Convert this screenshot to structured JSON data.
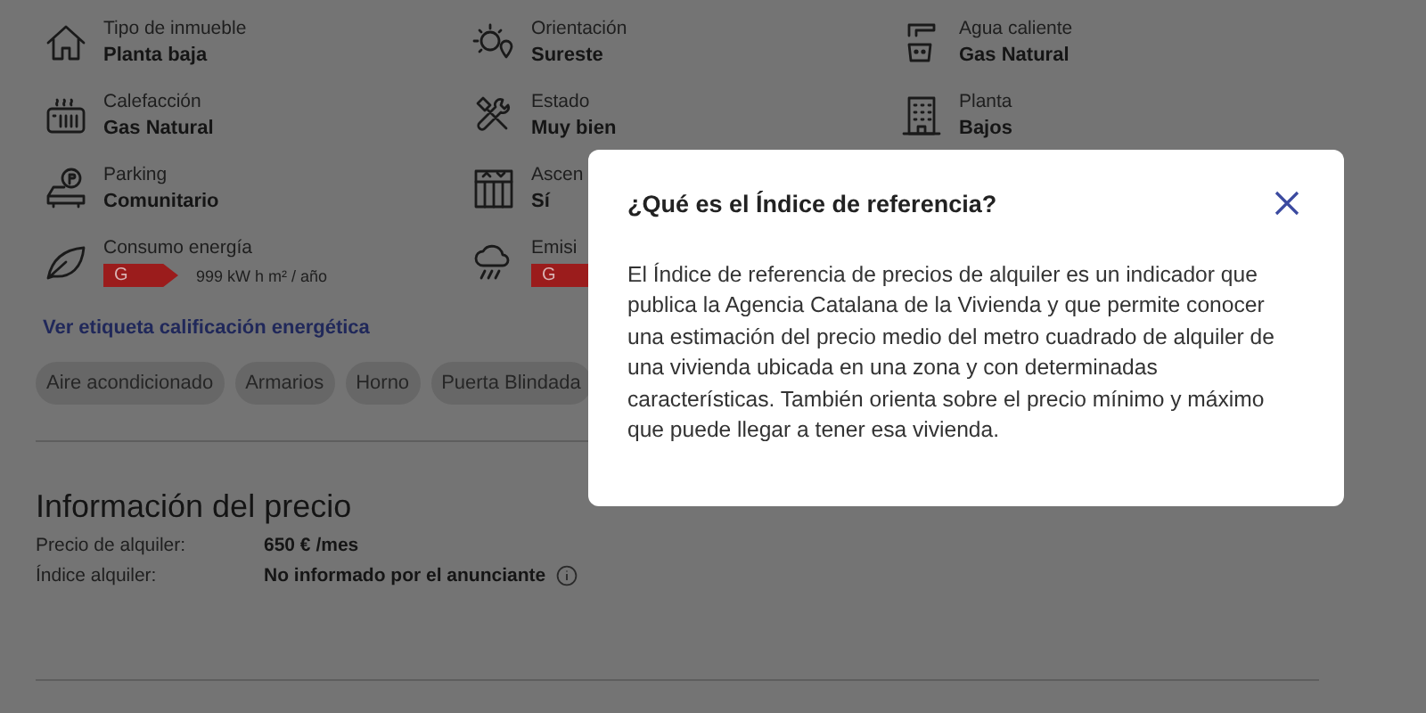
{
  "feature_rows": [
    [
      {
        "kind": "text",
        "label": "Tipo de inmueble",
        "value": "Planta baja"
      },
      {
        "kind": "text",
        "label": "Orientación",
        "value": "Sureste"
      },
      {
        "kind": "text",
        "label": "Agua caliente",
        "value": "Gas Natural"
      }
    ],
    [
      {
        "kind": "text",
        "label": "Calefacción",
        "value": "Gas Natural"
      },
      {
        "kind": "text",
        "label": "Estado",
        "value": "Muy bien"
      },
      {
        "kind": "text",
        "label": "Planta",
        "value": "Bajos"
      }
    ],
    [
      {
        "kind": "text",
        "label": "Parking",
        "value": "Comunitario"
      },
      {
        "kind": "text",
        "label": "Ascen",
        "value": "Sí"
      }
    ],
    [
      {
        "kind": "energy",
        "label": "Consumo energía",
        "rating": "G",
        "color": "#9b1c1c",
        "reading": "999 kW h m² / año"
      },
      {
        "kind": "energy",
        "label": "Emisi",
        "rating": "G",
        "color": "#9b1c1c"
      }
    ]
  ],
  "energy_link": "Ver etiqueta calificación energética",
  "tags": [
    "Aire acondicionado",
    "Armarios",
    "Horno",
    "Puerta Blindada"
  ],
  "price_section": {
    "title": "Información del precio",
    "rows": [
      {
        "label": "Precio de alquiler:",
        "value": "650 € /mes",
        "info": false
      },
      {
        "label": "Índice alquiler:",
        "value": "No informado por el anunciante",
        "info": true
      }
    ]
  },
  "modal": {
    "title": "¿Qué es el Índice de referencia?",
    "body": "El Índice de referencia de precios de alquiler es un indicador que publica la Agencia Catalana de la Vivienda y que permite conocer una estimación del precio medio del metro cuadrado de alquiler de una vivienda ubicada en una zona y con determinadas características. También orienta sobre el precio mínimo y máximo que puede llegar a tener esa vivienda."
  }
}
